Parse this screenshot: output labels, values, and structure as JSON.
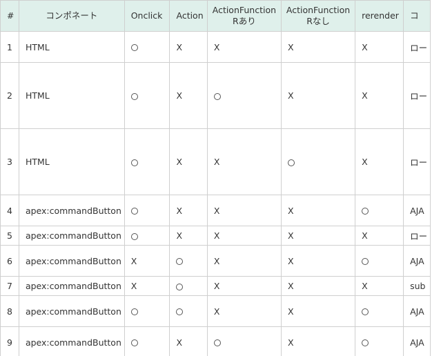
{
  "table": {
    "headers": [
      "#",
      "コンポネート",
      "Onclick",
      "Action",
      "ActionFunction Rあり",
      "ActionFunction Rなし",
      "rerender",
      "コ"
    ],
    "header_af_r_line1": "ActionFunction",
    "header_af_r_line2": "Rあり",
    "header_af_n_line1": "ActionFunction",
    "header_af_n_line2": "Rなし",
    "header_color": "#dff0eb",
    "rows": [
      {
        "num": "1",
        "component": "HTML",
        "onclick": "O",
        "action": "X",
        "af_r": "X",
        "af_n": "X",
        "rerender": "X",
        "last": "ロー"
      },
      {
        "num": "2",
        "component": "HTML",
        "onclick": "O",
        "action": "X",
        "af_r": "O",
        "af_n": "X",
        "rerender": "X",
        "last": "ロー"
      },
      {
        "num": "3",
        "component": "HTML",
        "onclick": "O",
        "action": "X",
        "af_r": "X",
        "af_n": "O",
        "rerender": "X",
        "last": "ロー"
      },
      {
        "num": "4",
        "component": "apex:commandButton",
        "onclick": "O",
        "action": "X",
        "af_r": "X",
        "af_n": "X",
        "rerender": "O",
        "last": "AJA"
      },
      {
        "num": "5",
        "component": "apex:commandButton",
        "onclick": "O",
        "action": "X",
        "af_r": "X",
        "af_n": "X",
        "rerender": "X",
        "last": "ロー"
      },
      {
        "num": "6",
        "component": "apex:commandButton",
        "onclick": "X",
        "action": "O",
        "af_r": "X",
        "af_n": "X",
        "rerender": "O",
        "last": "AJA"
      },
      {
        "num": "7",
        "component": "apex:commandButton",
        "onclick": "X",
        "action": "O",
        "af_r": "X",
        "af_n": "X",
        "rerender": "X",
        "last": "sub"
      },
      {
        "num": "8",
        "component": "apex:commandButton",
        "onclick": "O",
        "action": "O",
        "af_r": "X",
        "af_n": "X",
        "rerender": "O",
        "last": "AJA"
      },
      {
        "num": "9",
        "component": "apex:commandButton",
        "onclick": "O",
        "action": "X",
        "af_r": "O",
        "af_n": "X",
        "rerender": "O",
        "last": "AJA"
      }
    ]
  }
}
